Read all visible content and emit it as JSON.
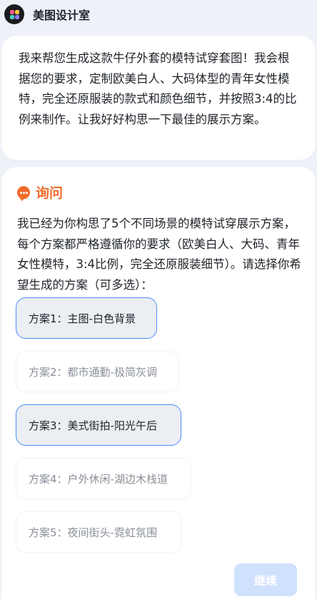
{
  "app": {
    "title": "美图设计室",
    "logo_icon": "meitu-logo-icon"
  },
  "assistant_message": {
    "text": "我来帮您生成这款牛仔外套的模特试穿套图！我会根据您的要求，定制欧美白人、大码体型的青年女性模特，完全还原服装的款式和颜色细节，并按照3:4的比例来制作。让我好好构思一下最佳的展示方案。"
  },
  "inquiry": {
    "label": "询问",
    "icon": "speech-bubble-icon",
    "accent_color": "#f26b2a",
    "intro": "我已经为你构思了5个不同场景的模特试穿展示方案，每个方案都严格遵循你的要求（欧美白人、大码、青年女性模特，3:4比例，完全还原服装细节）。请选择你希望生成的方案（可多选）：",
    "options": [
      {
        "label": "方案1：主图-白色背景",
        "selected": true
      },
      {
        "label": "方案2：都市通勤-极简灰调",
        "selected": false
      },
      {
        "label": "方案3：美式街拍-阳光午后",
        "selected": true
      },
      {
        "label": "方案4：户外休闲-湖边木栈道",
        "selected": false
      },
      {
        "label": "方案5：夜间街头-霓虹氛围",
        "selected": false
      }
    ],
    "continue_label": "继续"
  },
  "colors": {
    "selected_border": "#4b8df8",
    "continue_bg": "#cfe1fc"
  }
}
